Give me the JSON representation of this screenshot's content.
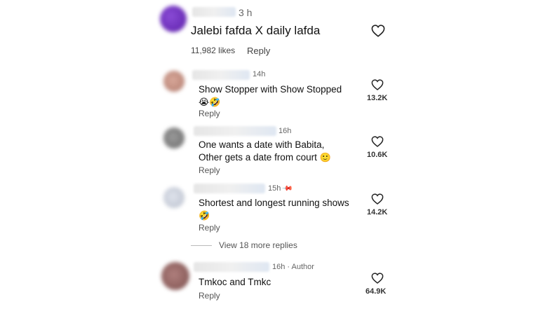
{
  "main": {
    "time": "3 h",
    "text": "Jalebi fafda X daily lafda",
    "likes": "11,982 likes",
    "reply": "Reply"
  },
  "replies": [
    {
      "time": "14h",
      "line1": "Show Stopper with Show Stopped",
      "emoji": "😭🤣",
      "reply": "Reply",
      "likes": "13.2K"
    },
    {
      "time": "16h",
      "line1": "One wants a date with Babita,",
      "line2": "Other gets a date from court",
      "emoji": "🙂",
      "reply": "Reply",
      "likes": "10.6K"
    },
    {
      "time": "15h",
      "line1": "Shortest and longest running shows",
      "emoji": "🤣",
      "reply": "Reply",
      "likes": "14.2K"
    },
    {
      "time": "16h",
      "author": "· Author",
      "line1": "Tmkoc and Tmkc",
      "reply": "Reply",
      "likes": "64.9K"
    }
  ],
  "view_more": "View 18 more replies",
  "icons": {
    "like": "heart-icon",
    "pin": "pin-icon"
  }
}
